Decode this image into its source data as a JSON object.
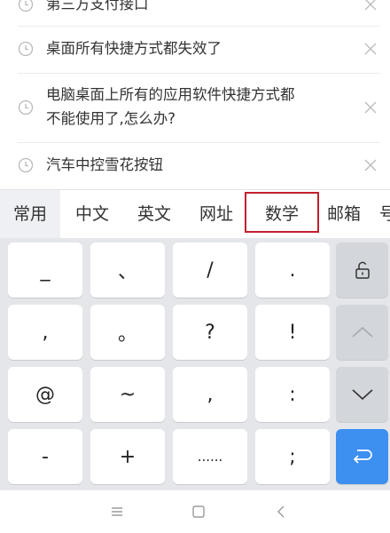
{
  "history": [
    {
      "text": "第三方支付接口"
    },
    {
      "text": "桌面所有快捷方式都失效了"
    },
    {
      "text": "电脑桌面上所有的应用软件快捷方式都",
      "text2": "不能使用了,怎么办?"
    },
    {
      "text": "汽车中控雪花按钮"
    }
  ],
  "categories": [
    "常用",
    "中文",
    "英文",
    "网址",
    "数学",
    "邮箱",
    "号"
  ],
  "selected_category": "数学",
  "keys": {
    "r1": [
      "_",
      "、",
      "/",
      "."
    ],
    "r2": [
      ",",
      "。",
      "?",
      "!"
    ],
    "r3": [
      "@",
      "~",
      ",",
      ":"
    ],
    "r4": [
      "-",
      "+",
      "......",
      ";"
    ]
  },
  "side_keys": [
    "lock-icon",
    "up-arrow-icon",
    "down-arrow-icon",
    "enter-icon"
  ],
  "colors": {
    "accent": "#3d8ff0",
    "highlight_border": "#c3202e"
  },
  "nav": [
    "menu-icon",
    "home-icon",
    "back-icon"
  ]
}
